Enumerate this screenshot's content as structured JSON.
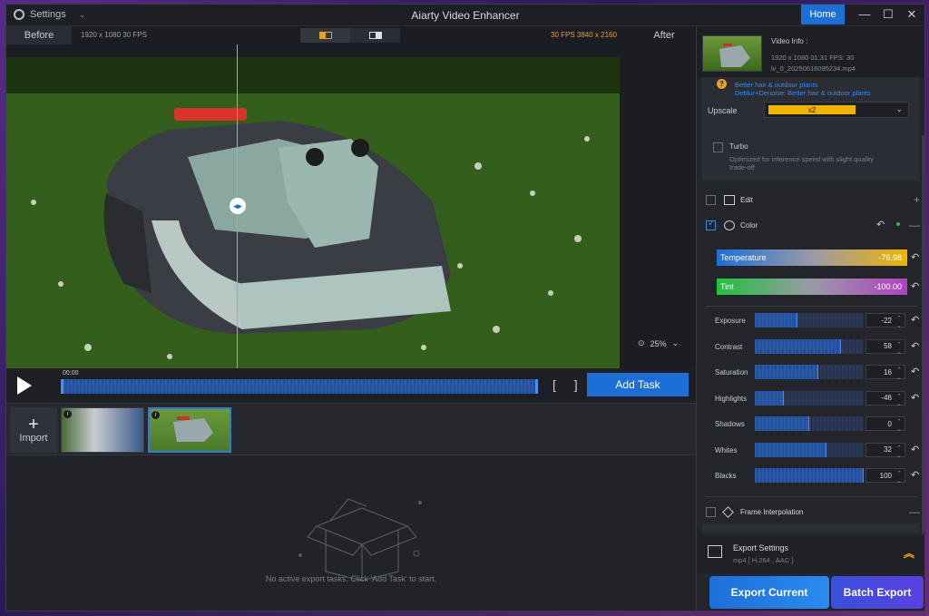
{
  "titlebar": {
    "settings_label": "Settings",
    "app_title": "Aiarty Video Enhancer",
    "home_label": "Home",
    "minimize": "—",
    "maximize": "☐",
    "close": "✕"
  },
  "preview": {
    "before_label": "Before",
    "after_label": "After",
    "source_info": "1920 x 1080  30 FPS",
    "target_info": "30 FPS  3840 x 2160",
    "zoom": "25%",
    "compare_handle": "◂▸"
  },
  "playbar": {
    "time": "00:00",
    "add_task_label": "Add Task",
    "brackets": "[ ]"
  },
  "media": {
    "import_label": "Import",
    "import_plus": "+",
    "info_badge": "i"
  },
  "export_area": {
    "empty_message": "No active export tasks. Click 'Add Task' to start."
  },
  "video_info": {
    "title": "Video Info :",
    "line1": "1920 x 1080  01:31   FPS: 30",
    "line2": "lv_0_20250616095234.mp4"
  },
  "upscale": {
    "warning_icon": "?",
    "warning_text": "Better hair & outdoor plants",
    "warning_line2": "Deblur+Denoise: Better hair & outdoor plants",
    "label": "Upscale",
    "value": "x2",
    "turbo_label": "Turbo",
    "turbo_desc": "Optimized for inference speed with slight quality trade-off"
  },
  "sections": {
    "edit_label": "Edit",
    "color_label": "Color",
    "frame_label": "Frame Interpolation",
    "plus": "+",
    "minus": "—"
  },
  "color": {
    "temperature_label": "Temperature",
    "temperature_value": "-76.98",
    "tint_label": "Tint",
    "tint_value": "-100.00",
    "sliders": [
      {
        "label": "Exposure",
        "value": "-22",
        "fill": 0.39
      },
      {
        "label": "Contrast",
        "value": "58",
        "fill": 0.79
      },
      {
        "label": "Saturation",
        "value": "16",
        "fill": 0.58
      },
      {
        "label": "Highlights",
        "value": "-46",
        "fill": 0.27
      },
      {
        "label": "Shadows",
        "value": "0",
        "fill": 0.5
      },
      {
        "label": "Whites",
        "value": "32",
        "fill": 0.66
      },
      {
        "label": "Blacks",
        "value": "100",
        "fill": 1.0
      }
    ]
  },
  "export_settings": {
    "title": "Export Settings",
    "subtitle": "mp4 [ H.264 , AAC ]",
    "export_current_label": "Export Current",
    "batch_export_label": "Batch Export"
  }
}
